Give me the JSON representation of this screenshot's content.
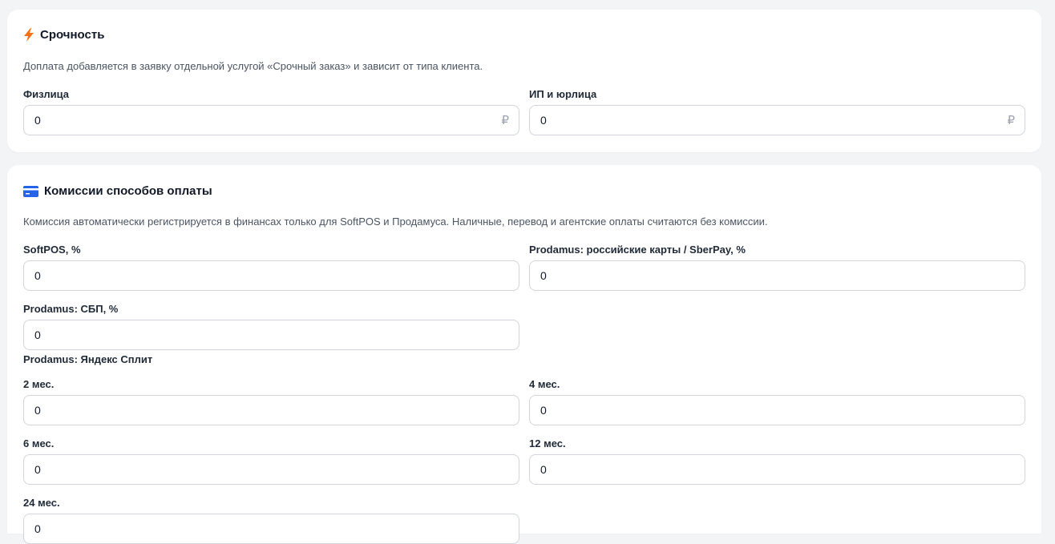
{
  "urgency": {
    "title": "Срочность",
    "description": "Доплата добавляется в заявку отдельной услугой «Срочный заказ» и зависит от типа клиента.",
    "fields": [
      {
        "label": "Физлица",
        "value": "0",
        "suffix": "₽"
      },
      {
        "label": "ИП и юрлица",
        "value": "0",
        "suffix": "₽"
      }
    ]
  },
  "fees": {
    "title": "Комиссии способов оплаты",
    "description": "Комиссия автоматически регистрируется в финансах только для SoftPOS и Продамуса. Наличные, перевод и агентские оплаты считаются без комиссии.",
    "softpos": {
      "label": "SoftPOS, %",
      "value": "0"
    },
    "prodamus_cards": {
      "label": "Prodamus: российские карты / SberPay, %",
      "value": "0"
    },
    "prodamus_sbp": {
      "label": "Prodamus: СБП, %",
      "value": "0"
    },
    "split_heading": "Prodamus: Яндекс Сплит",
    "split": [
      {
        "label": "2 мес.",
        "value": "0"
      },
      {
        "label": "4 мес.",
        "value": "0"
      },
      {
        "label": "6 мес.",
        "value": "0"
      },
      {
        "label": "12 мес.",
        "value": "0"
      },
      {
        "label": "24 мес.",
        "value": "0"
      }
    ]
  },
  "colors": {
    "accent_bolt": "#f97316",
    "accent_card": "#2563eb"
  },
  "icons": {
    "urgency": "lightning-bolt-icon",
    "fees": "credit-card-icon"
  }
}
